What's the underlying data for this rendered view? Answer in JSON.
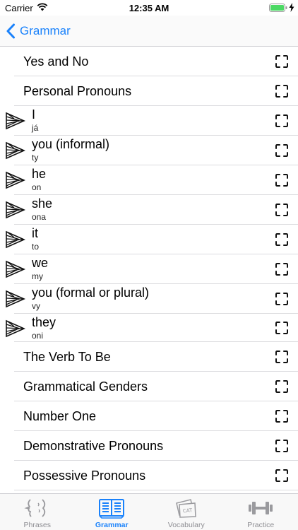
{
  "status_bar": {
    "carrier": "Carrier",
    "time": "12:35 AM",
    "icons": [
      "wifi-icon",
      "battery-icon",
      "charging-icon"
    ]
  },
  "nav": {
    "back_label": "Grammar",
    "back_icon": "chevron-left-icon",
    "accent_color": "#1a82fb"
  },
  "sections_top": [
    {
      "label": "Yes and No"
    },
    {
      "label": "Personal Pronouns"
    }
  ],
  "pronouns": [
    {
      "title": "I",
      "translation": "já"
    },
    {
      "title": "you (informal)",
      "translation": "ty"
    },
    {
      "title": "he",
      "translation": "on"
    },
    {
      "title": "she",
      "translation": "ona"
    },
    {
      "title": "it",
      "translation": "to"
    },
    {
      "title": "we",
      "translation": "my"
    },
    {
      "title": "you (formal or plural)",
      "translation": "vy"
    },
    {
      "title": "they",
      "translation": "oni"
    }
  ],
  "sections_bottom": [
    {
      "label": "The Verb To Be"
    },
    {
      "label": "Grammatical Genders"
    },
    {
      "label": "Number One"
    },
    {
      "label": "Demonstrative Pronouns"
    },
    {
      "label": "Possessive Pronouns"
    }
  ],
  "row_icons": {
    "speaker": "speaker-icon",
    "expand": "expand-icon"
  },
  "tabs": [
    {
      "label": "Phrases",
      "icon": "phrases-icon",
      "active": false
    },
    {
      "label": "Grammar",
      "icon": "grammar-book-icon",
      "active": true
    },
    {
      "label": "Vocabulary",
      "icon": "vocabulary-cards-icon",
      "active": false
    },
    {
      "label": "Practice",
      "icon": "dumbbell-icon",
      "active": false
    }
  ]
}
